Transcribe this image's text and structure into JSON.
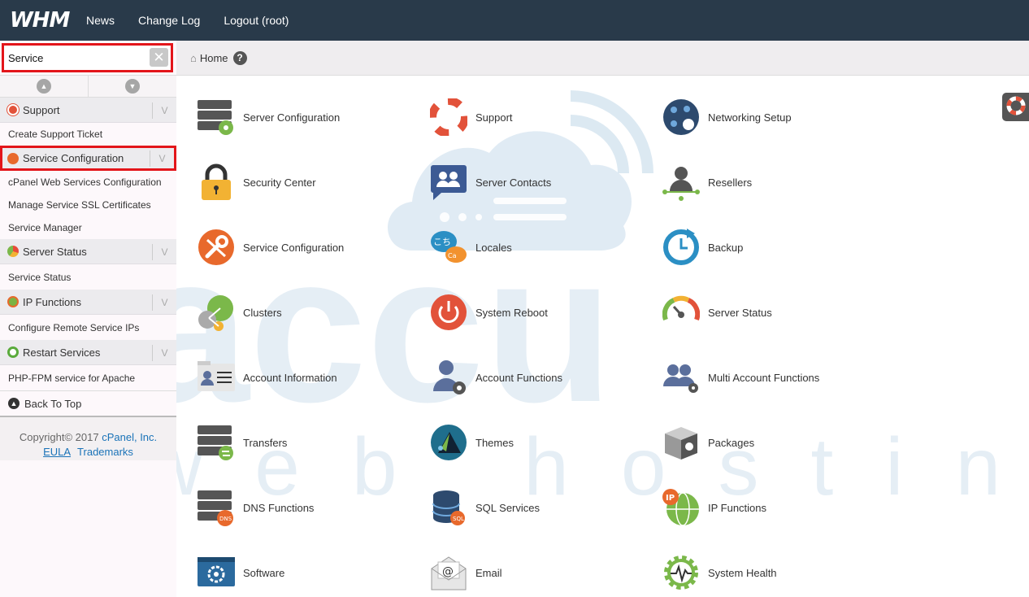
{
  "topbar": {
    "logo": "WHM",
    "nav": [
      "News",
      "Change Log",
      "Logout (root)"
    ]
  },
  "sidebar": {
    "search_value": "Service",
    "categories": [
      {
        "label": "Support",
        "items": [
          "Create Support Ticket"
        ]
      },
      {
        "label": "Service Configuration",
        "items": [
          "cPanel Web Services Configuration",
          "Manage Service SSL Certificates",
          "Service Manager"
        ]
      },
      {
        "label": "Server Status",
        "items": [
          "Service Status"
        ]
      },
      {
        "label": "IP Functions",
        "items": [
          "Configure Remote Service IPs"
        ]
      },
      {
        "label": "Restart Services",
        "items": [
          "PHP-FPM service for Apache"
        ]
      }
    ],
    "back_to_top": "Back To Top",
    "copyright": "Copyright© 2017",
    "company": "cPanel, Inc.",
    "eula": "EULA",
    "trademarks": "Trademarks"
  },
  "breadcrumb": {
    "home": "Home"
  },
  "tiles": [
    [
      "Server Configuration",
      "Support",
      "Networking Setup"
    ],
    [
      "Security Center",
      "Server Contacts",
      "Resellers"
    ],
    [
      "Service Configuration",
      "Locales",
      "Backup"
    ],
    [
      "Clusters",
      "System Reboot",
      "Server Status"
    ],
    [
      "Account Information",
      "Account Functions",
      "Multi Account Functions"
    ],
    [
      "Transfers",
      "Themes",
      "Packages"
    ],
    [
      "DNS Functions",
      "SQL Services",
      "IP Functions"
    ],
    [
      "Software",
      "Email",
      "System Health"
    ]
  ],
  "watermark": {
    "brand": "accu",
    "sub": "web hosting"
  },
  "colors": {
    "topbar": "#293a4a",
    "highlight": "#e3151a",
    "link": "#1a73b8"
  }
}
